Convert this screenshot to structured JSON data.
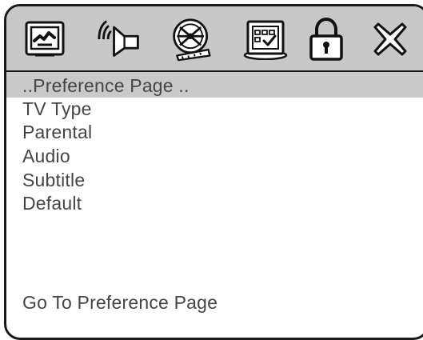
{
  "toolbar": {
    "icons": [
      {
        "name": "system-setup-icon"
      },
      {
        "name": "audio-speaker-icon"
      },
      {
        "name": "video-film-reel-icon"
      },
      {
        "name": "preference-panel-icon"
      },
      {
        "name": "parental-lock-icon"
      },
      {
        "name": "exit-close-icon"
      }
    ]
  },
  "menu": {
    "header": "..Preference Page ..",
    "items": [
      "TV Type",
      "Parental",
      "Audio",
      "Subtitle",
      "Default"
    ]
  },
  "status": {
    "hint": "Go To Preference Page"
  },
  "colors": {
    "toolbar_bg": "#c8c8c8",
    "highlight_bg": "#c9c9c9",
    "text": "#454545",
    "outline": "#1a1a1a"
  }
}
